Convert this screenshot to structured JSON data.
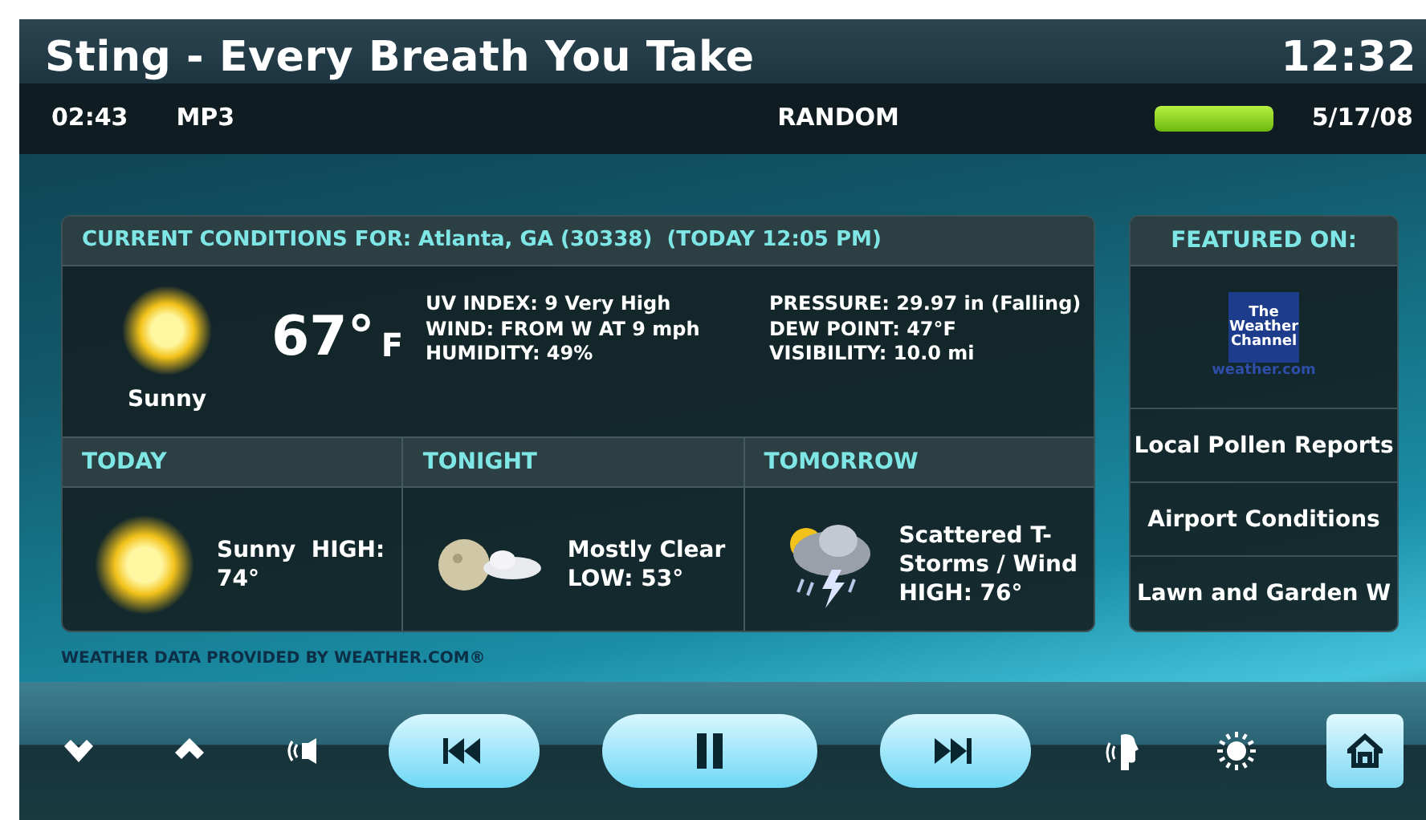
{
  "header": {
    "title": "Sting - Every Breath You Take",
    "clock": "12:32",
    "elapsed": "02:43",
    "format": "MP3",
    "mode": "RANDOM",
    "meter": {
      "level": 1
    },
    "date": "5/17/08"
  },
  "current": {
    "heading": "CURRENT CONDITIONS FOR: Atlanta, GA (30338)  (TODAY 12:05 PM)",
    "condition": "Sunny",
    "temperature": "67°",
    "unit": "F",
    "details_left": [
      "UV INDEX: 9 Very High",
      "WIND: FROM W AT 9 mph",
      "HUMIDITY: 49%"
    ],
    "details_right": [
      "PRESSURE: 29.97 in (Falling)",
      "DEW POINT: 47°F",
      "VISIBILITY: 10.0 mi"
    ]
  },
  "forecast": [
    {
      "label": "TODAY",
      "kind": "sun",
      "text": [
        "Sunny  HIGH:",
        "74°"
      ]
    },
    {
      "label": "TONIGHT",
      "kind": "moon",
      "text": [
        "Mostly Clear",
        "LOW: 53°"
      ]
    },
    {
      "label": "TOMORROW",
      "kind": "storm",
      "text": [
        "Scattered T-",
        "Storms / Wind",
        "HIGH: 76°"
      ]
    }
  ],
  "credit": "WEATHER DATA PROVIDED BY WEATHER.COM®",
  "featured": {
    "heading": "FEATURED ON:",
    "logo_lines": [
      "The",
      "Weather",
      "Channel"
    ],
    "logo_site": "weather.com",
    "links": [
      "Local Pollen Reports",
      "Airport Conditions",
      "Lawn and Garden W"
    ]
  },
  "controls": [
    {
      "kind": "down"
    },
    {
      "kind": "up"
    },
    {
      "kind": "speaker"
    },
    {
      "kind": "prev"
    },
    {
      "kind": "pause"
    },
    {
      "kind": "next"
    },
    {
      "kind": "voice"
    },
    {
      "kind": "brightness"
    },
    {
      "kind": "home"
    }
  ]
}
